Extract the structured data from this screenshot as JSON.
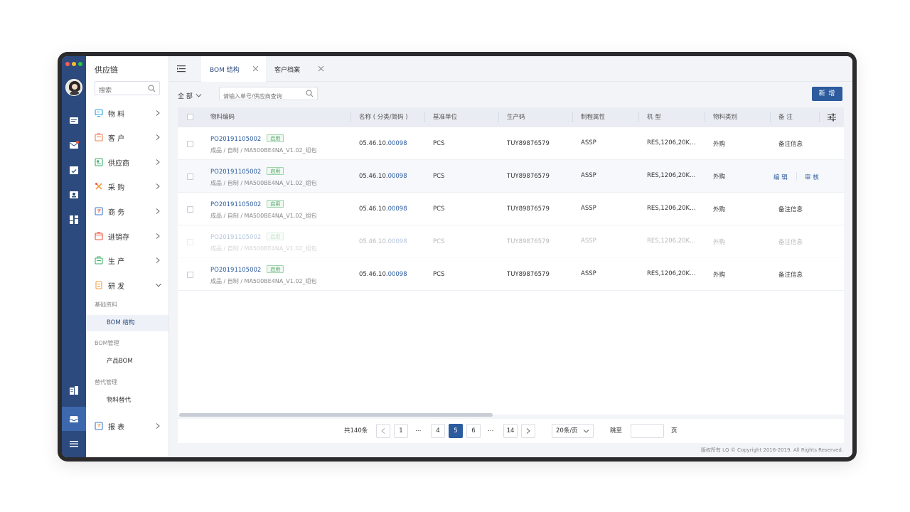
{
  "window": {
    "traffic_lights": [
      "#ff5f57",
      "#febc2e",
      "#28c840"
    ]
  },
  "rail": {
    "icons": [
      "message-icon",
      "mail-notice-icon",
      "calendar-check-icon",
      "contact-card-icon",
      "dashboard-icon",
      "building-icon",
      "inbox-icon",
      "menu-icon"
    ],
    "active_color": "#3d68ad"
  },
  "sidebar": {
    "title": "供应链",
    "search_placeholder": "搜索",
    "items": [
      {
        "label": "物 料",
        "icon": "monitor-icon",
        "color": "#2a9fd8"
      },
      {
        "label": "客 户",
        "icon": "customer-icon",
        "color": "#f08050"
      },
      {
        "label": "供应商",
        "icon": "supplier-icon",
        "color": "#3fae6a"
      },
      {
        "label": "采 购",
        "icon": "tools-icon",
        "color": "#f0a040"
      },
      {
        "label": "商 务",
        "icon": "business-icon",
        "color": "#3a7bd5"
      },
      {
        "label": "进销存",
        "icon": "inventory-icon",
        "color": "#e8553e"
      },
      {
        "label": "生 产",
        "icon": "production-icon",
        "color": "#3fae6a"
      },
      {
        "label": "研 发",
        "icon": "research-icon",
        "color": "#f0a040"
      },
      {
        "label": "报 表",
        "icon": "report-icon",
        "color": "#3a7bd5"
      }
    ],
    "sub_groups": [
      {
        "label": "基础资料",
        "items": [
          "BOM 结构"
        ]
      },
      {
        "label": "BOM管理",
        "items": [
          "产品BOM"
        ]
      },
      {
        "label": "替代管理",
        "items": [
          "物料替代"
        ]
      }
    ]
  },
  "tabs": [
    {
      "label": "BOM 结构",
      "active": true
    },
    {
      "label": "客户档案",
      "active": false
    }
  ],
  "toolbar": {
    "filter_label": "全 部",
    "search_placeholder": "请输入单号/供应商查询",
    "new_button": "新 增"
  },
  "table": {
    "columns": [
      "物料编码",
      "名称 ( 分类/简码 )",
      "基准单位",
      "生产码",
      "制程属性",
      "机 型",
      "物料类别",
      "备 注"
    ],
    "rows": [
      {
        "code": "PO20191105002",
        "tag": "启用",
        "path": "成品 / 自制 / MA500BE4NA_V1.02_组包",
        "name_prefix": "05.46.10.",
        "name_suffix": "00098",
        "unit": "PCS",
        "prod_code": "TUY89876579",
        "process": "ASSP",
        "model": "RES,1206,20K…",
        "category": "外购",
        "remark": "备注信息"
      },
      {
        "code": "PO20191105002",
        "tag": "启用",
        "path": "成品 / 自制 / MA500BE4NA_V1.02_组包",
        "name_prefix": "05.46.10.",
        "name_suffix": "00098",
        "unit": "PCS",
        "prod_code": "TUY89876579",
        "process": "ASSP",
        "model": "RES,1206,20K…",
        "category": "外购",
        "remark": ""
      },
      {
        "code": "PO20191105002",
        "tag": "启用",
        "path": "成品 / 自制 / MA500BE4NA_V1.02_组包",
        "name_prefix": "05.46.10.",
        "name_suffix": "00098",
        "unit": "PCS",
        "prod_code": "TUY89876579",
        "process": "ASSP",
        "model": "RES,1206,20K…",
        "category": "外购",
        "remark": "备注信息"
      },
      {
        "code": "PO20191105002",
        "tag": "启用",
        "path": "成品 / 自制 / MA500BE4NA_V1.02_组包",
        "name_prefix": "05.46.10.",
        "name_suffix": "00098",
        "unit": "PCS",
        "prod_code": "TUY89876579",
        "process": "ASSP",
        "model": "RES,1206,20K…",
        "category": "外购",
        "remark": "备注信息"
      },
      {
        "code": "PO20191105002",
        "tag": "启用",
        "path": "成品 / 自制 / MA500BE4NA_V1.02_组包",
        "name_prefix": "05.46.10.",
        "name_suffix": "00098",
        "unit": "PCS",
        "prod_code": "TUY89876579",
        "process": "ASSP",
        "model": "RES,1206,20K…",
        "category": "外购",
        "remark": "备注信息"
      }
    ],
    "hover_actions": [
      "编 辑",
      "审 核"
    ]
  },
  "pagination": {
    "total": "共140条",
    "pages": [
      "1",
      "…",
      "4",
      "5",
      "6",
      "…",
      "14"
    ],
    "current": "5",
    "page_size": "20条/页",
    "jump_label": "跳至",
    "page_unit": "页"
  },
  "footer": {
    "copyright": "版权所有 LQ © Copyright 2016-2019. All Rights Reserved."
  }
}
